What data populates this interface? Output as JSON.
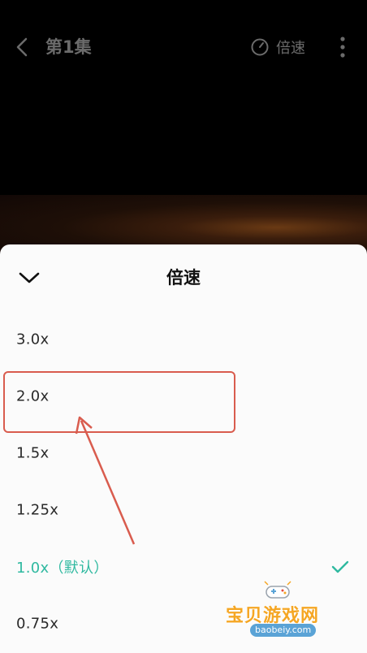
{
  "header": {
    "episode_title": "第1集",
    "speed_label": "倍速"
  },
  "sheet": {
    "title": "倍速",
    "options": [
      {
        "label": "3.0x",
        "selected": false
      },
      {
        "label": "2.0x",
        "selected": false
      },
      {
        "label": "1.5x",
        "selected": false
      },
      {
        "label": "1.25x",
        "selected": false
      },
      {
        "label": "1.0x（默认）",
        "selected": true
      },
      {
        "label": "0.75x",
        "selected": false
      }
    ]
  },
  "watermark": {
    "text": "宝贝游戏网",
    "url": "baobeiy.com"
  },
  "colors": {
    "accent": "#2fb9a0",
    "annotation": "#d95c4e"
  }
}
